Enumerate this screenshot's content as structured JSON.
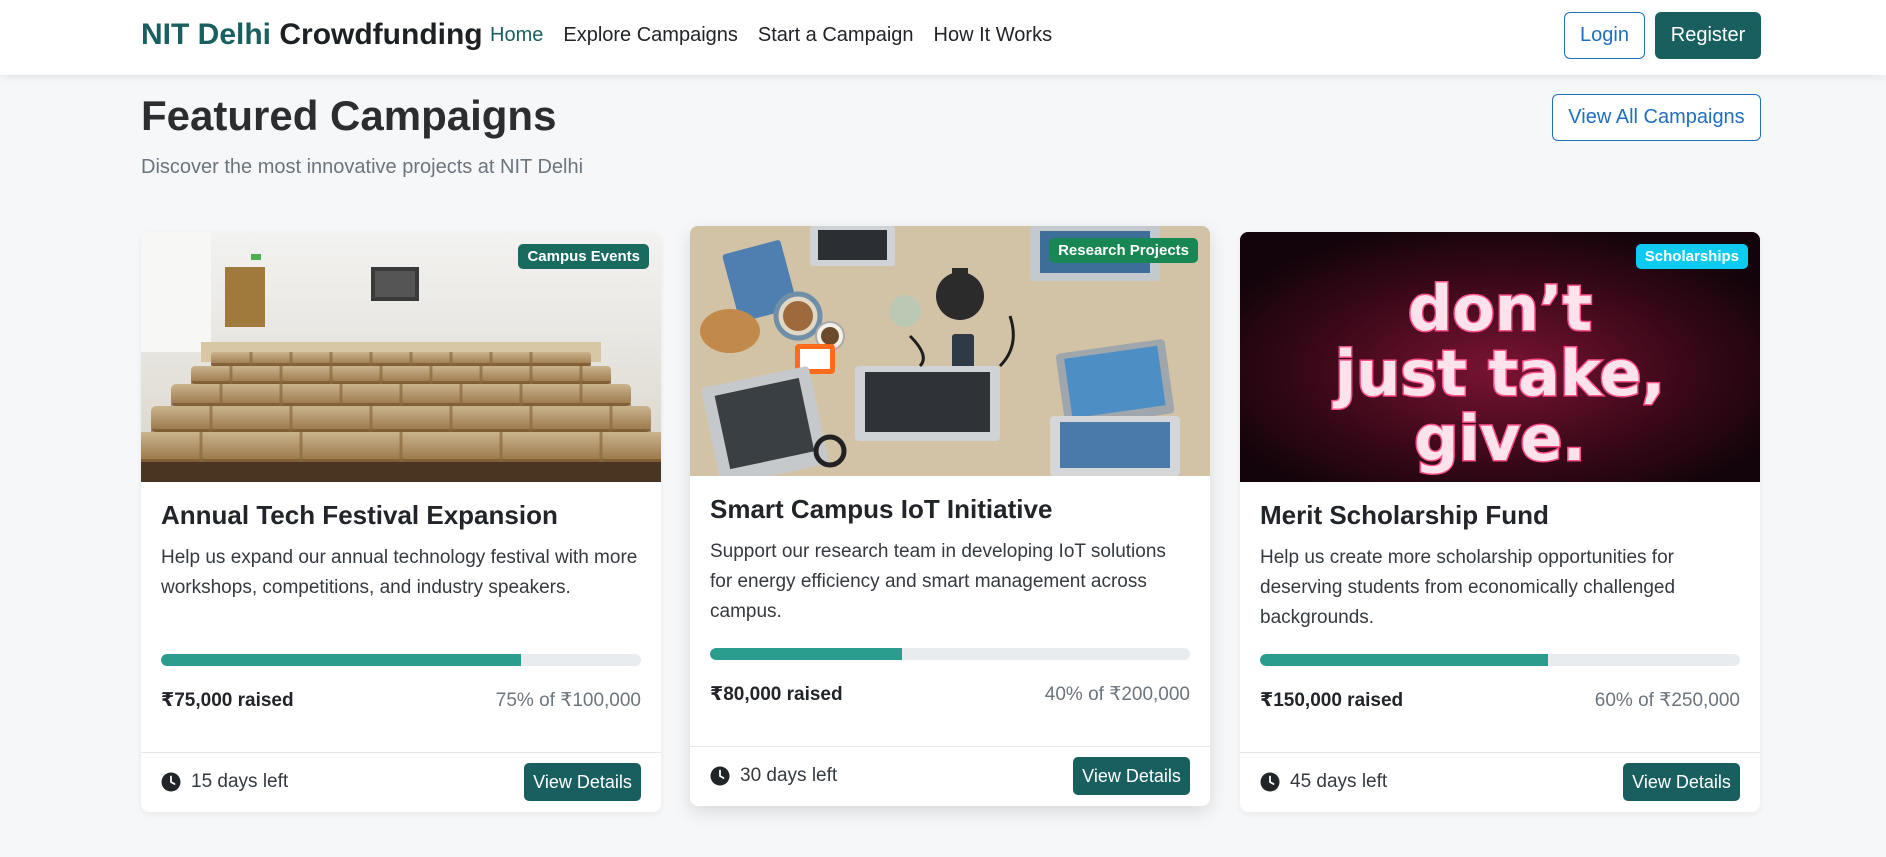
{
  "nav": {
    "brand_accent": "NIT Delhi",
    "brand_rest": "Crowdfunding",
    "links": [
      "Home",
      "Explore Campaigns",
      "Start a Campaign",
      "How It Works"
    ],
    "login": "Login",
    "register": "Register"
  },
  "section": {
    "title": "Featured Campaigns",
    "subtitle": "Discover the most innovative projects at NIT Delhi",
    "view_all": "View All Campaigns"
  },
  "campaigns": [
    {
      "badge": "Campus Events",
      "badge_color": "#1a6b5f",
      "image": "lecture-hall-photo",
      "title": "Annual Tech Festival Expansion",
      "description": "Help us expand our annual technology festival with more workshops, competitions, and industry speakers.",
      "progress_percent": 75,
      "raised": "₹75,000 raised",
      "percent_of_goal": "75% of ₹100,000",
      "days_left": "15 days left",
      "button": "View Details"
    },
    {
      "badge": "Research Projects",
      "badge_color": "#198754",
      "image": "workspace-laptops-photo",
      "title": "Smart Campus IoT Initiative",
      "description": "Support our research team in developing IoT solutions for energy efficiency and smart management across campus.",
      "progress_percent": 40,
      "raised": "₹80,000 raised",
      "percent_of_goal": "40% of ₹200,000",
      "days_left": "30 days left",
      "button": "View Details"
    },
    {
      "badge": "Scholarships",
      "badge_color": "#0dcaf0",
      "image": "neon-sign-photo",
      "image_text": [
        "don’t",
        "just take,",
        "give."
      ],
      "title": "Merit Scholarship Fund",
      "description": "Help us create more scholarship opportunities for deserving students from economically challenged backgrounds.",
      "progress_percent": 60,
      "raised": "₹150,000 raised",
      "percent_of_goal": "60% of ₹250,000",
      "days_left": "45 days left",
      "button": "View Details"
    }
  ]
}
